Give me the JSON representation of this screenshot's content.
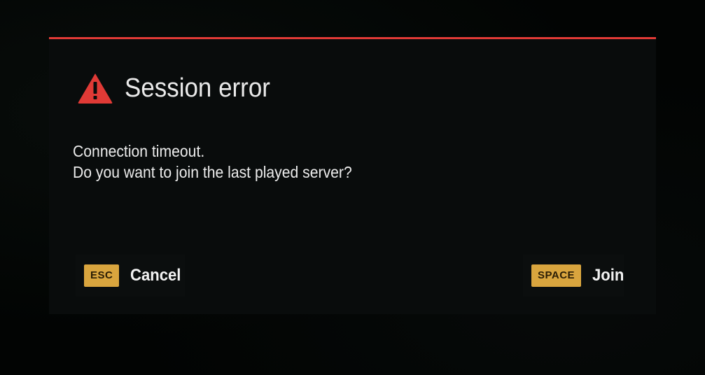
{
  "dialog": {
    "title": "Session error",
    "icon": "warning-triangle-icon",
    "accent_color": "#e03a36",
    "message_lines": [
      "Connection timeout.",
      "Do you want to join the last played server?"
    ]
  },
  "actions": {
    "cancel": {
      "key": "ESC",
      "label": "Cancel"
    },
    "join": {
      "key": "SPACE",
      "label": "Join"
    },
    "key_color": "#d9a53e"
  }
}
